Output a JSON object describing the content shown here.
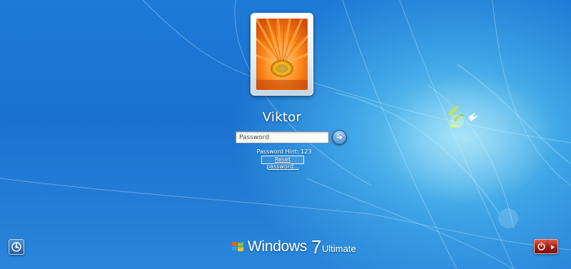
{
  "login": {
    "user_name": "Viktor",
    "password_placeholder": "Password",
    "password_value": "",
    "password_hint": "Password Hint: 123",
    "reset_password_label": "Reset password..."
  },
  "branding": {
    "word": "Windows",
    "version": "7",
    "edition": "Ultimate"
  },
  "icons": {
    "go": "arrow-right-icon",
    "ease_of_access": "ease-of-access-icon",
    "power": "power-icon",
    "power_options": "triangle-right-icon",
    "logo": "windows-flag-icon",
    "user_picture": "orange-flower-picture"
  },
  "colors": {
    "background": "#1d7ad7",
    "power_button": "#a51d12",
    "ease_button": "#245a9a"
  }
}
